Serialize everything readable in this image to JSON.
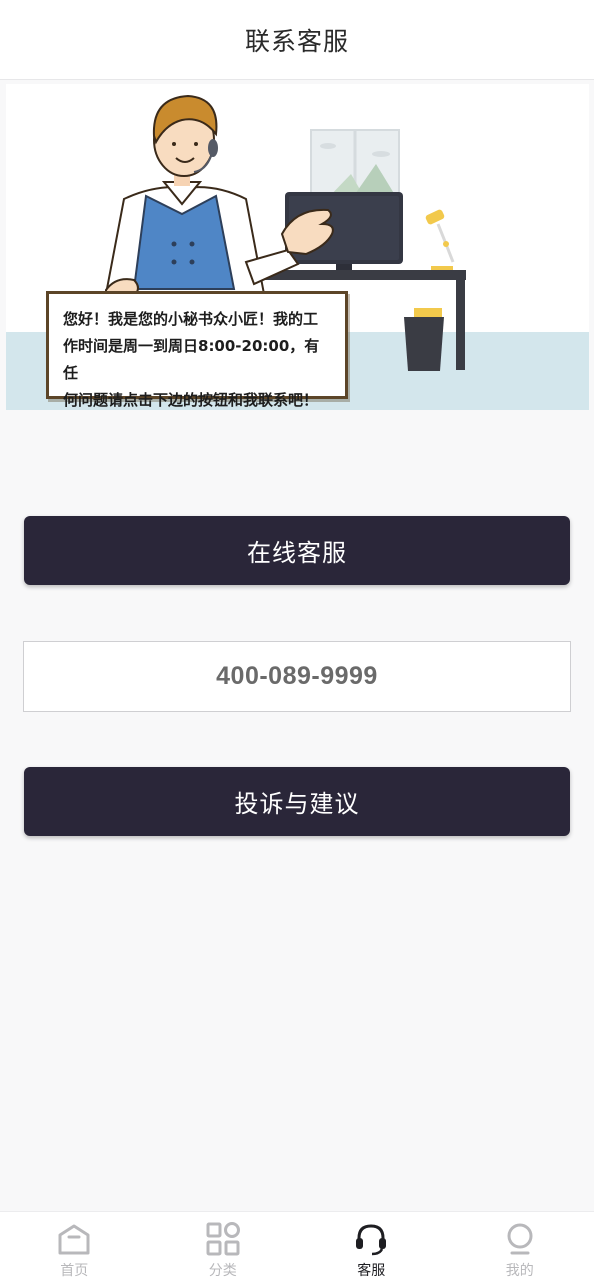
{
  "header": {
    "title": "联系客服"
  },
  "banner": {
    "speech_lines": [
      "您好！我是您的小秘书众小匠！我的工",
      "作时间是周一到周日8:00-20:00，有任",
      "何问题请点击下边的按钮和我联系吧！"
    ]
  },
  "buttons": {
    "online_service": "在线客服",
    "phone": "400-089-9999",
    "complaint": "投诉与建议"
  },
  "tabbar": {
    "items": [
      {
        "label": "首页",
        "icon": "home-icon",
        "active": false
      },
      {
        "label": "分类",
        "icon": "grid-icon",
        "active": false
      },
      {
        "label": "客服",
        "icon": "headset-icon",
        "active": true
      },
      {
        "label": "我的",
        "icon": "profile-icon",
        "active": false
      }
    ]
  },
  "colors": {
    "primary_dark": "#2a2639",
    "tab_inactive": "#b8b8bb",
    "tab_active": "#1e1e22",
    "banner_floor": "#d3e6ec"
  }
}
